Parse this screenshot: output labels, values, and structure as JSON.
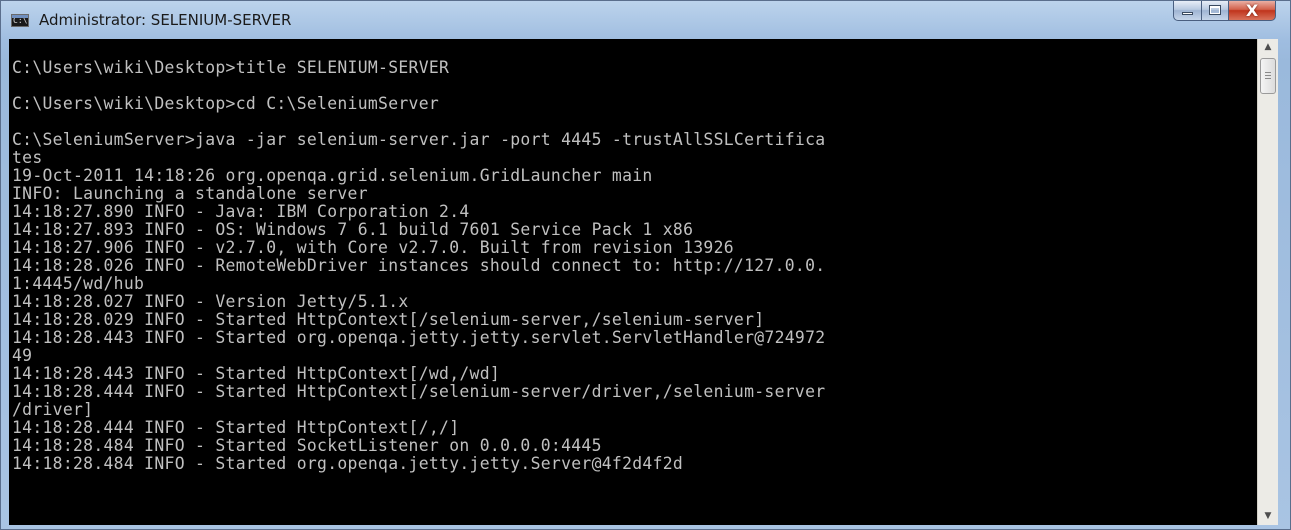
{
  "window": {
    "title": "Administrator: SELENIUM-SERVER",
    "icon": "cmd-icon",
    "icon_text": "C:\\",
    "buttons": {
      "minimize_icon": "minimize-icon",
      "maximize_icon": "maximize-icon",
      "close_icon": "close-icon",
      "close_glyph": "X"
    }
  },
  "console": {
    "background": "#000000",
    "foreground": "#c0c0c0",
    "lines": [
      "",
      "C:\\Users\\wiki\\Desktop>title SELENIUM-SERVER",
      "",
      "C:\\Users\\wiki\\Desktop>cd C:\\SeleniumServer",
      "",
      "C:\\SeleniumServer>java -jar selenium-server.jar -port 4445 -trustAllSSLCertifica",
      "tes",
      "19-Oct-2011 14:18:26 org.openqa.grid.selenium.GridLauncher main",
      "INFO: Launching a standalone server",
      "14:18:27.890 INFO - Java: IBM Corporation 2.4",
      "14:18:27.893 INFO - OS: Windows 7 6.1 build 7601 Service Pack 1 x86",
      "14:18:27.906 INFO - v2.7.0, with Core v2.7.0. Built from revision 13926",
      "14:18:28.026 INFO - RemoteWebDriver instances should connect to: http://127.0.0.",
      "1:4445/wd/hub",
      "14:18:28.027 INFO - Version Jetty/5.1.x",
      "14:18:28.029 INFO - Started HttpContext[/selenium-server,/selenium-server]",
      "14:18:28.443 INFO - Started org.openqa.jetty.jetty.servlet.ServletHandler@724972",
      "49",
      "14:18:28.443 INFO - Started HttpContext[/wd,/wd]",
      "14:18:28.444 INFO - Started HttpContext[/selenium-server/driver,/selenium-server",
      "/driver]",
      "14:18:28.444 INFO - Started HttpContext[/,/]",
      "14:18:28.484 INFO - Started SocketListener on 0.0.0.0:4445",
      "14:18:28.484 INFO - Started org.openqa.jetty.jetty.Server@4f2d4f2d"
    ]
  },
  "scrollbar": {
    "up_icon": "scroll-up-arrow-icon",
    "down_icon": "scroll-down-arrow-icon",
    "up_glyph": "▲",
    "down_glyph": "▼"
  }
}
